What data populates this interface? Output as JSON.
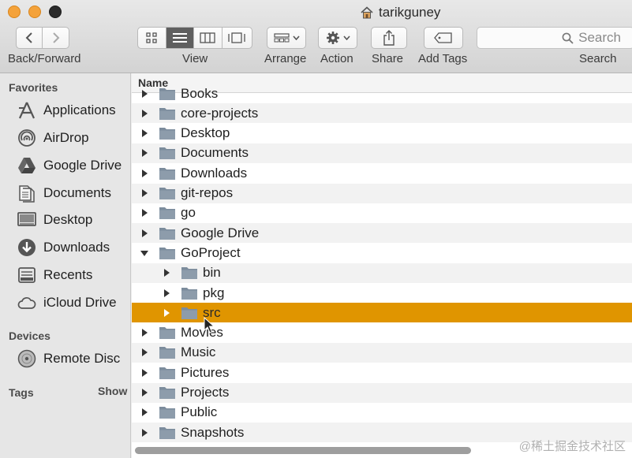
{
  "window": {
    "title": "tarikguney",
    "traffic_lights": [
      "close",
      "minimize",
      "maximize"
    ]
  },
  "toolbar": {
    "back_forward_label": "Back/Forward",
    "view_label": "View",
    "arrange_label": "Arrange",
    "action_label": "Action",
    "share_label": "Share",
    "add_tags_label": "Add Tags",
    "search_label": "Search",
    "search_placeholder": "Search",
    "active_view": "list"
  },
  "sidebar": {
    "favorites_heading": "Favorites",
    "favorites": [
      {
        "label": "Applications",
        "icon": "applications-icon"
      },
      {
        "label": "AirDrop",
        "icon": "airdrop-icon"
      },
      {
        "label": "Google Drive",
        "icon": "google-drive-icon"
      },
      {
        "label": "Documents",
        "icon": "documents-icon"
      },
      {
        "label": "Desktop",
        "icon": "desktop-icon"
      },
      {
        "label": "Downloads",
        "icon": "downloads-icon"
      },
      {
        "label": "Recents",
        "icon": "recents-icon"
      },
      {
        "label": "iCloud Drive",
        "icon": "icloud-icon"
      }
    ],
    "devices_heading": "Devices",
    "devices": [
      {
        "label": "Remote Disc",
        "icon": "disc-icon"
      }
    ],
    "tags_heading": "Tags",
    "tags_show": "Show"
  },
  "list": {
    "column_name": "Name",
    "rows": [
      {
        "name": "Books",
        "expanded": false,
        "level": 0
      },
      {
        "name": "core-projects",
        "expanded": false,
        "level": 0
      },
      {
        "name": "Desktop",
        "expanded": false,
        "level": 0
      },
      {
        "name": "Documents",
        "expanded": false,
        "level": 0
      },
      {
        "name": "Downloads",
        "expanded": false,
        "level": 0
      },
      {
        "name": "git-repos",
        "expanded": false,
        "level": 0
      },
      {
        "name": "go",
        "expanded": false,
        "level": 0
      },
      {
        "name": "Google Drive",
        "expanded": false,
        "level": 0
      },
      {
        "name": "GoProject",
        "expanded": true,
        "level": 0
      },
      {
        "name": "bin",
        "expanded": false,
        "level": 1
      },
      {
        "name": "pkg",
        "expanded": false,
        "level": 1
      },
      {
        "name": "src",
        "expanded": false,
        "level": 1,
        "selected": true
      },
      {
        "name": "Movies",
        "expanded": false,
        "level": 0
      },
      {
        "name": "Music",
        "expanded": false,
        "level": 0
      },
      {
        "name": "Pictures",
        "expanded": false,
        "level": 0
      },
      {
        "name": "Projects",
        "expanded": false,
        "level": 0
      },
      {
        "name": "Public",
        "expanded": false,
        "level": 0
      },
      {
        "name": "Snapshots",
        "expanded": false,
        "level": 0
      }
    ]
  },
  "colors": {
    "selection": "#e09500",
    "folder": "#7c8c9c",
    "traffic_orange": "#f4a23a"
  },
  "watermark": "@稀土掘金技术社区"
}
